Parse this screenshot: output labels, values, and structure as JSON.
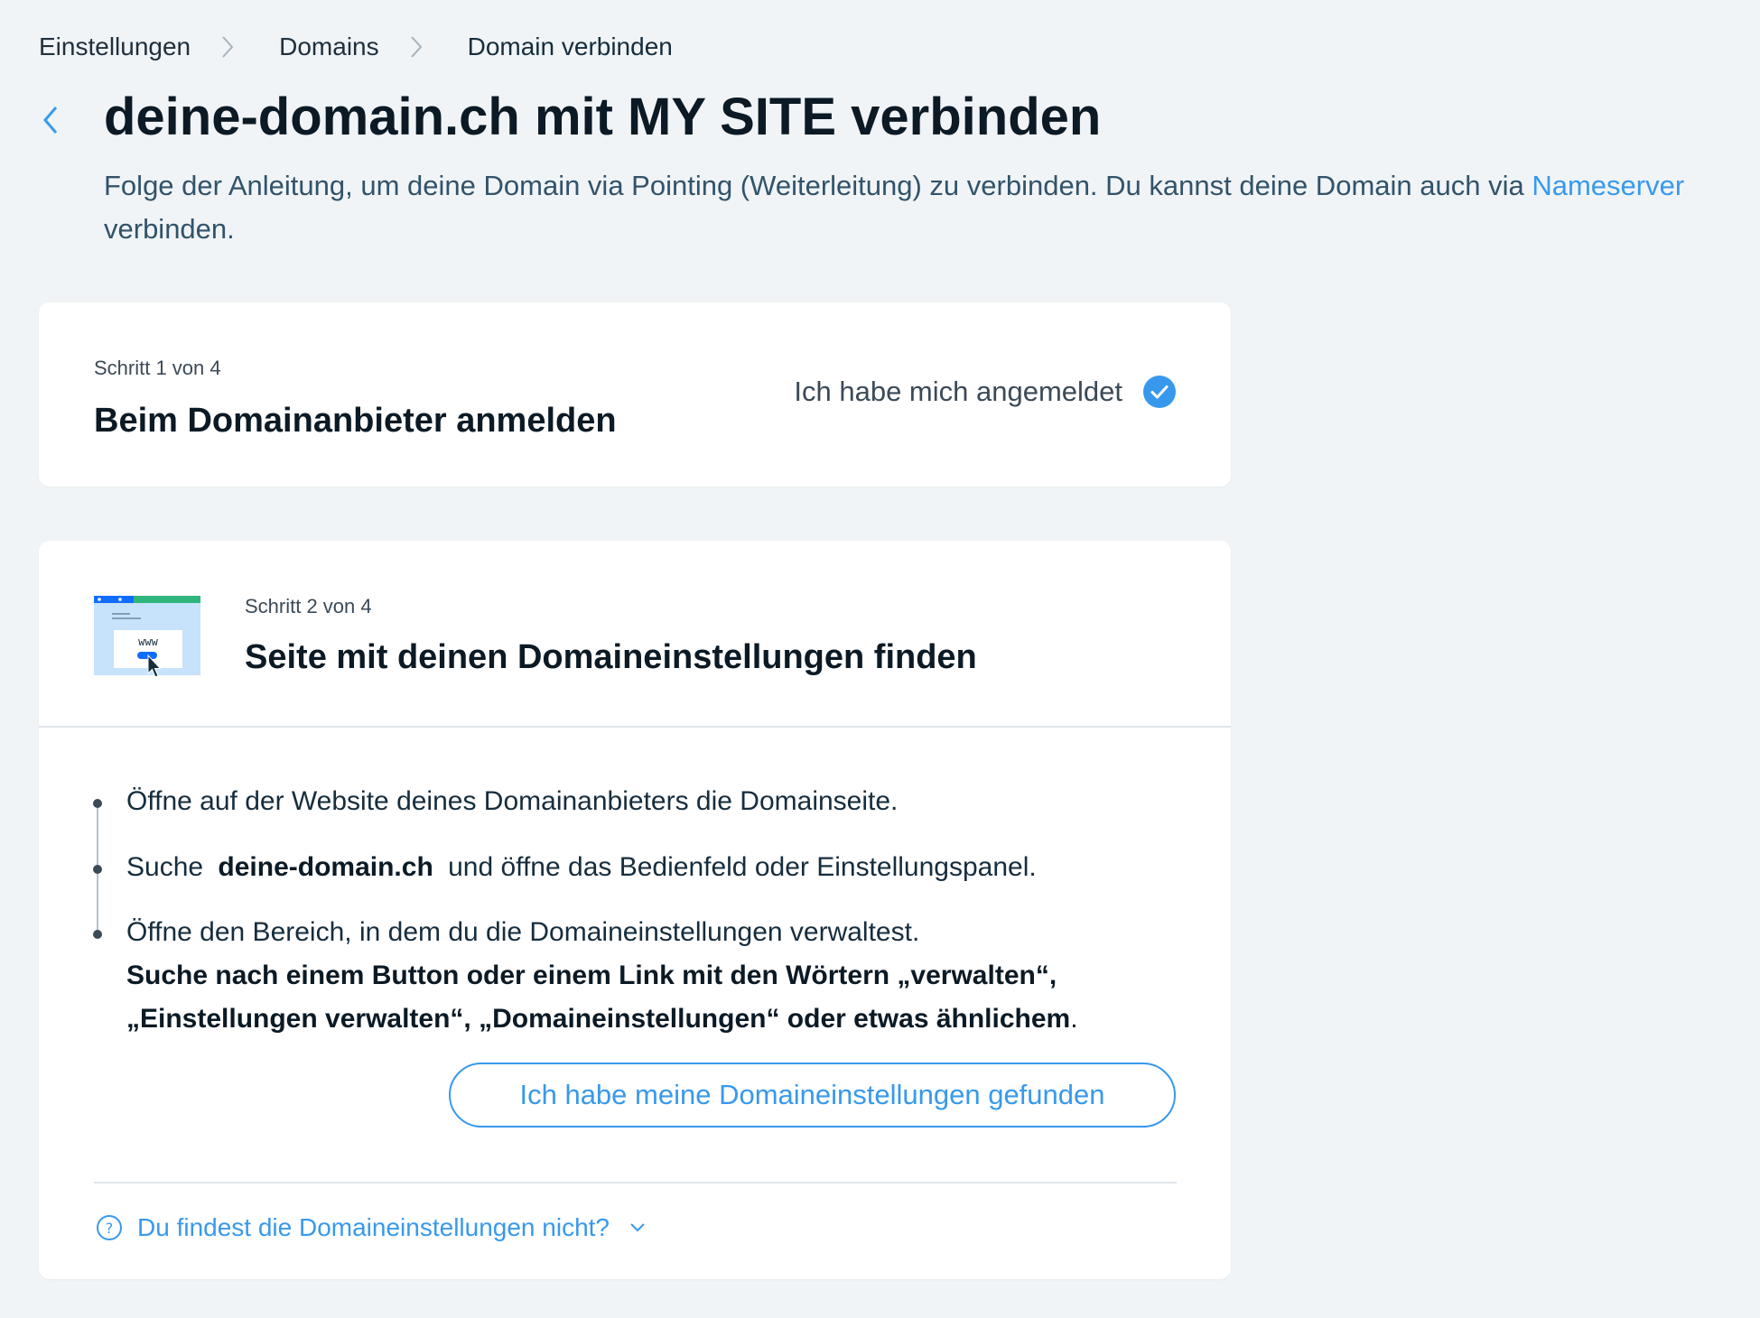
{
  "breadcrumb": {
    "items": [
      "Einstellungen",
      "Domains"
    ],
    "current": "Domain verbinden"
  },
  "header": {
    "title": "deine-domain.ch mit MY SITE verbinden",
    "subtitle_before": "Folge der Anleitung, um deine Domain via Pointing (Weiterleitung) zu verbinden. Du kannst deine Domain auch via ",
    "subtitle_link": "Nameserver",
    "subtitle_after": " verbinden."
  },
  "step1": {
    "label": "Schritt 1 von 4",
    "title": "Beim Domainanbieter anmelden",
    "done_label": "Ich habe mich angemeldet"
  },
  "step2": {
    "label": "Schritt 2 von 4",
    "title": "Seite mit deinen Domaineinstellungen finden",
    "illustration_text": "www",
    "instructions": {
      "item1": "Öffne auf der Website deines Domainanbieters die Domainseite.",
      "item2_before": "Suche ",
      "item2_domain": "deine-domain.ch",
      "item2_after": " und öffne das Bedienfeld oder Einstellungspanel.",
      "item3": "Öffne den Bereich, in dem du die Domaineinstellungen verwaltest.",
      "item3_bold_line1": "Suche nach einem Button oder einem Link mit den Wörtern „verwalten“,",
      "item3_bold_line2": "„Einstellungen verwalten“, „Domaineinstellungen“ oder etwas ähnlichem",
      "item3_period": "."
    },
    "found_button": "Ich habe meine Domaineinstellungen gefunden",
    "help_link": "Du findest die Domaineinstellungen nicht?"
  },
  "colors": {
    "accent": "#3899ec",
    "background": "#f0f4f7",
    "text_dark": "#0b1a25",
    "illustration_green": "#2fb67c",
    "illustration_blue": "#116dff"
  },
  "icons": [
    "chevron-right-icon",
    "chevron-left-icon",
    "check-circle-icon",
    "question-circle-icon",
    "chevron-down-icon"
  ]
}
